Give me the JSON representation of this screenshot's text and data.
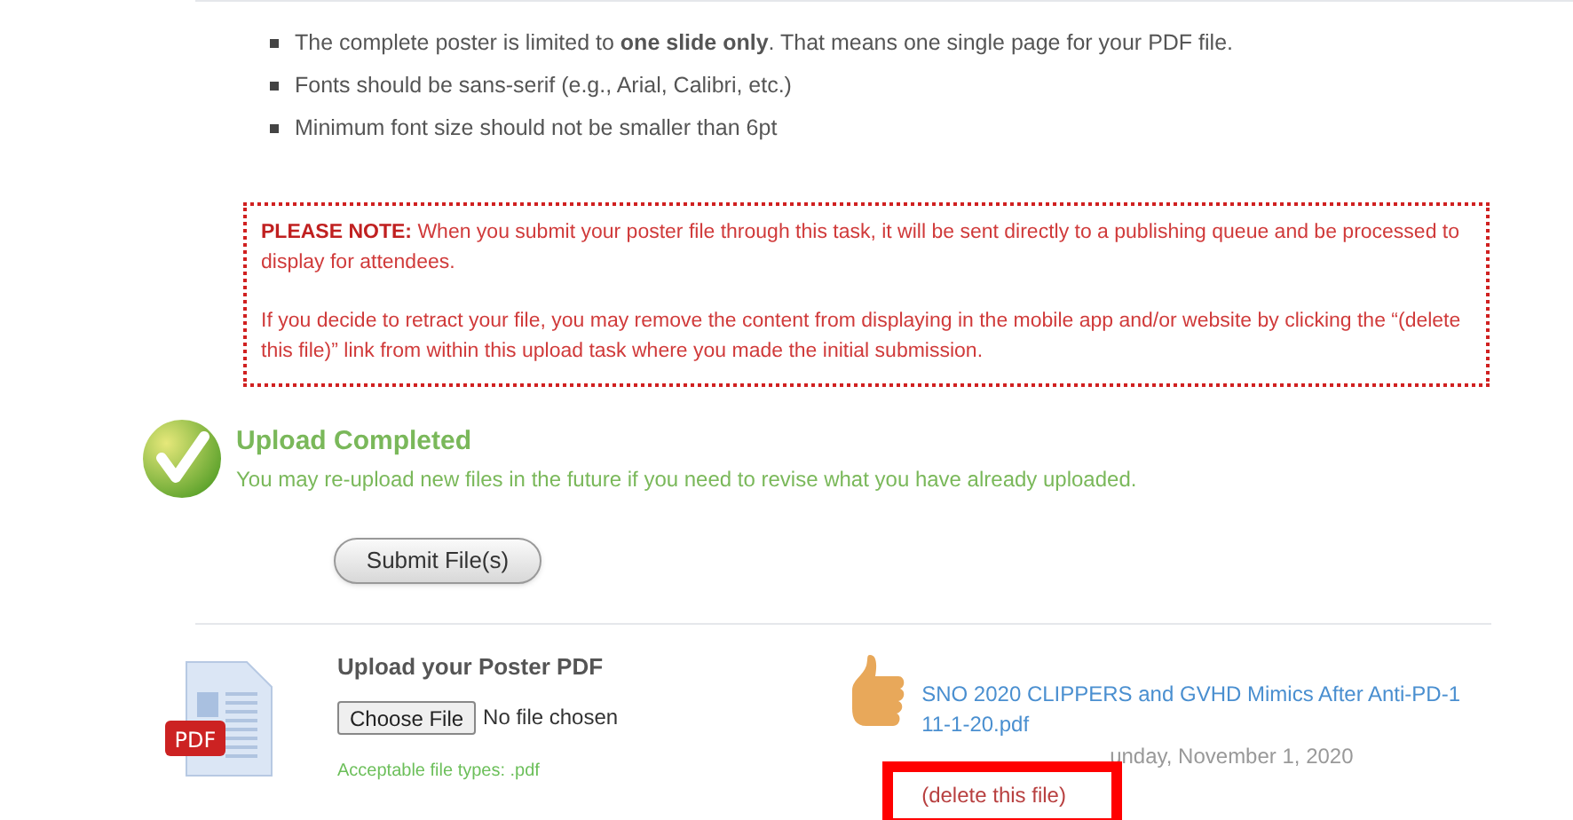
{
  "guidelines": [
    "The complete poster is limited to **one slide only**. That means one single page for your PDF file.",
    "Fonts should be sans-serif (e.g., Arial, Calibri, etc.)",
    "Minimum font size should not be smaller than 6pt"
  ],
  "note": {
    "label": "PLEASE NOTE:",
    "text": "When you submit your poster file through this task, it will be sent directly to a publishing queue and be processed to display for attendees.",
    "text2": "If you decide to retract your file, you may remove the content from displaying in the mobile app and/or website by clicking the “(delete this file)” link from within this upload task where you made the initial submission."
  },
  "status": {
    "title": "Upload Completed",
    "message": "You may re-upload new files in the future if you need to revise what you have already uploaded."
  },
  "submit_button": "Submit File(s)",
  "upload": {
    "label": "Upload your Poster PDF",
    "choose_button": "Choose File",
    "file_status": "No file chosen",
    "hint": "Acceptable file types: .pdf",
    "pdf_badge": "PDF"
  },
  "uploaded": {
    "file_name": "SNO 2020 CLIPPERS and GVHD Mimics After Anti-PD-1 11-1-20.pdf",
    "date": "unday, November 1, 2020",
    "delete_link": "(delete this file)"
  }
}
